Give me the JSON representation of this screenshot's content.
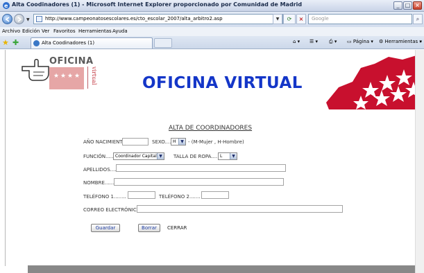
{
  "window": {
    "title": "Alta Coodinadores (1) - Microsoft Internet Explorer proporcionado por Comunidad de Madrid",
    "min_glyph": "_",
    "max_glyph": "□",
    "close_glyph": "×"
  },
  "address": {
    "url": "http://www.campeonatosescolares.es/cto_escolar_2007/alta_arbitro2.asp",
    "search_placeholder": "Google"
  },
  "menu": [
    "Archivo",
    "Edición",
    "Ver",
    "Favoritos",
    "Herramientas",
    "Ayuda"
  ],
  "tabs": {
    "active_label": "Alta Coodinadores (1)"
  },
  "commands": {
    "page": "Página",
    "tools": "Herramientas",
    "more": "»"
  },
  "banner": {
    "logo_text": "OFICINA",
    "logo_vertical": "virtual",
    "title": "OFICINA VIRTUAL"
  },
  "form": {
    "title": "ALTA DE COORDINADORES",
    "birth_year_label": "AÑO NACIMIENTO....",
    "sex_label": "SEXO....",
    "sex_value": "H",
    "sex_hint": "- (M-Mujer , H-Hombre)",
    "function_label": "FUNCIÓN..........",
    "function_value": "Coordinador Capital",
    "clothing_size_label": "TALLA DE ROPA.....",
    "clothing_size_value": "L",
    "surnames_label": "APELLIDOS.......",
    "name_label": "NOMBRE.........",
    "phone1_label": "TELÉFONO 1........",
    "phone2_label": "TELÉFONO 2.......",
    "email_label": "CORREO ELECTRÓNICO.",
    "save_button": "Guardar",
    "clear_button": "Borrar",
    "close_link": "CERRAR"
  },
  "colors": {
    "banner_title": "#1436c8",
    "madrid_red": "#c8102e",
    "button_text": "#1a3aa0"
  }
}
